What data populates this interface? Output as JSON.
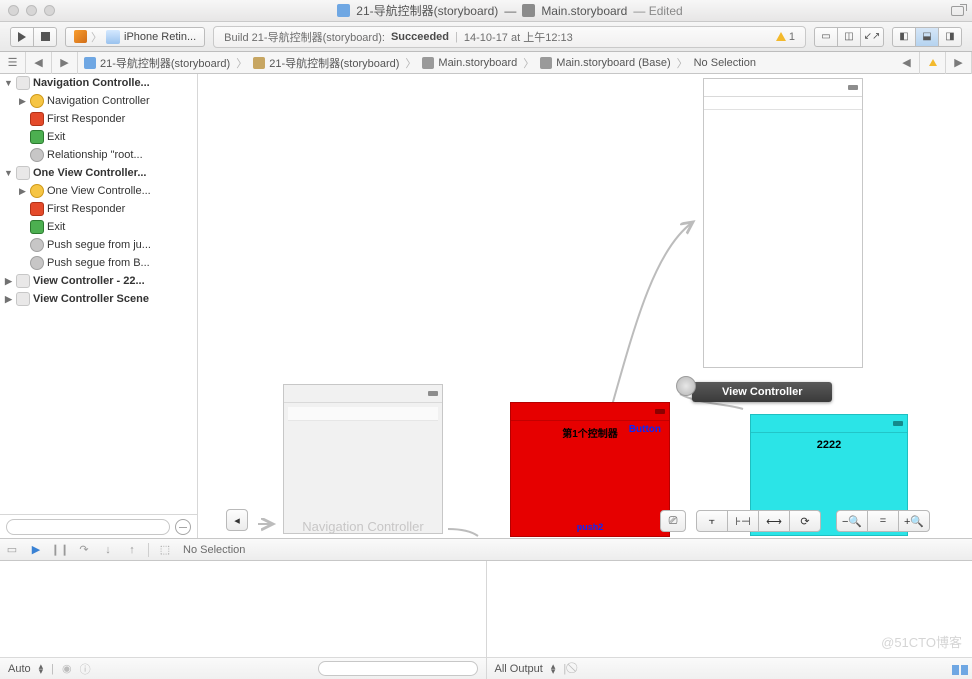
{
  "title": {
    "file": "21-导航控制器(storyboard)",
    "sep": "—",
    "storyboard": "Main.storyboard",
    "edited": "— Edited"
  },
  "toolbar": {
    "scheme_device": "iPhone Retin..."
  },
  "status": {
    "prefix": "Build 21-导航控制器(storyboard):",
    "result": "Succeeded",
    "time": "14-10-17 at 上午12:13",
    "warn_count": "1"
  },
  "jump": {
    "crumbs": [
      "21-导航控制器(storyboard)",
      "21-导航控制器(storyboard)",
      "Main.storyboard",
      "Main.storyboard (Base)",
      "No Selection"
    ]
  },
  "outline": {
    "scenes": [
      {
        "title": "Navigation Controlle...",
        "children": [
          "Navigation Controller",
          "First Responder",
          "Exit",
          "Relationship \"root..."
        ]
      },
      {
        "title": "One View Controller...",
        "children": [
          "One View Controlle...",
          "First Responder",
          "Exit",
          "Push segue from ju...",
          "Push segue from B..."
        ]
      },
      {
        "title": "View Controller - 22...",
        "children": []
      },
      {
        "title": "View Controller Scene",
        "children": []
      }
    ]
  },
  "canvas": {
    "nav_label": "Navigation Controller",
    "vc_badge": "View Controller",
    "red_title": "第1个控制器",
    "red_button": "Button",
    "red_push": "push2",
    "cyan_title": "2222"
  },
  "debug": {
    "no_selection": "No Selection"
  },
  "bottom": {
    "auto": "Auto",
    "all_output": "All Output",
    "watermark": "@51CTO博客"
  }
}
